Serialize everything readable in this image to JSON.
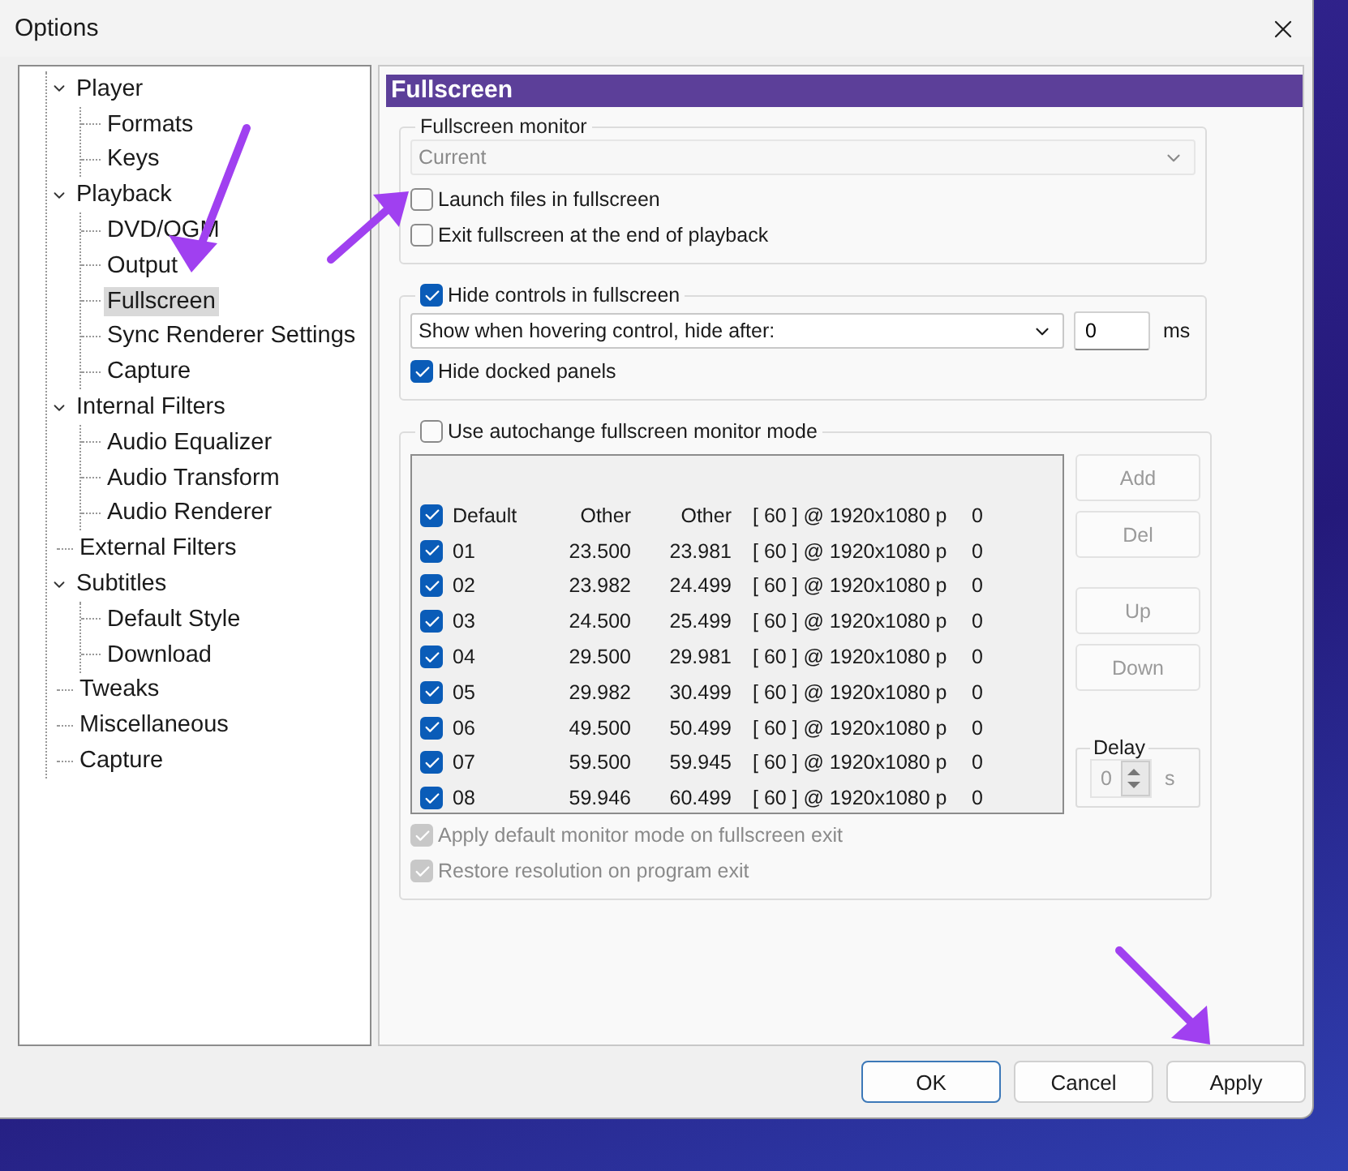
{
  "window": {
    "title": "Options"
  },
  "tree": [
    {
      "label": "Player",
      "expanded": true,
      "selected": false,
      "children": [
        {
          "label": "Formats",
          "selected": false
        },
        {
          "label": "Keys",
          "selected": false
        }
      ]
    },
    {
      "label": "Playback",
      "expanded": true,
      "selected": false,
      "children": [
        {
          "label": "DVD/OGM",
          "selected": false
        },
        {
          "label": "Output",
          "selected": false
        },
        {
          "label": "Fullscreen",
          "selected": true
        },
        {
          "label": "Sync Renderer Settings",
          "selected": false
        },
        {
          "label": "Capture",
          "selected": false
        }
      ]
    },
    {
      "label": "Internal Filters",
      "expanded": true,
      "selected": false,
      "children": [
        {
          "label": "Audio Equalizer",
          "selected": false
        },
        {
          "label": "Audio Transform",
          "selected": false
        },
        {
          "label": "Audio Renderer",
          "selected": false
        }
      ]
    },
    {
      "label": "External Filters",
      "selected": false
    },
    {
      "label": "Subtitles",
      "expanded": true,
      "selected": false,
      "children": [
        {
          "label": "Default Style",
          "selected": false
        },
        {
          "label": "Download",
          "selected": false
        }
      ]
    },
    {
      "label": "Tweaks",
      "selected": false
    },
    {
      "label": "Miscellaneous",
      "selected": false
    },
    {
      "label": "Capture",
      "selected": false
    }
  ],
  "panel": {
    "title": "Fullscreen",
    "monitor_group": {
      "label": "Fullscreen monitor",
      "dropdown": {
        "value": "Current",
        "disabled": true
      },
      "options": [
        {
          "label": "Launch files in fullscreen",
          "checked": false
        },
        {
          "label": "Exit fullscreen at the end of playback",
          "checked": false
        }
      ]
    },
    "hide_controls": {
      "label": "Hide controls in fullscreen",
      "checked": true,
      "dropdown": {
        "value": "Show when hovering control, hide after:"
      },
      "delay": {
        "value": "0",
        "unit": "ms"
      },
      "options": [
        {
          "label": "Hide docked panels",
          "checked": true
        }
      ]
    },
    "autochange": {
      "label": "Use autochange fullscreen monitor mode",
      "checked": false,
      "rows": [
        {
          "checked": true,
          "cells": [
            "Default",
            "Other",
            "Other",
            "[ 60 ] @ 1920x1080 p",
            "0"
          ]
        },
        {
          "checked": true,
          "cells": [
            "01",
            "23.500",
            "23.981",
            "[ 60 ] @ 1920x1080 p",
            "0"
          ]
        },
        {
          "checked": true,
          "cells": [
            "02",
            "23.982",
            "24.499",
            "[ 60 ] @ 1920x1080 p",
            "0"
          ]
        },
        {
          "checked": true,
          "cells": [
            "03",
            "24.500",
            "25.499",
            "[ 60 ] @ 1920x1080 p",
            "0"
          ]
        },
        {
          "checked": true,
          "cells": [
            "04",
            "29.500",
            "29.981",
            "[ 60 ] @ 1920x1080 p",
            "0"
          ]
        },
        {
          "checked": true,
          "cells": [
            "05",
            "29.982",
            "30.499",
            "[ 60 ] @ 1920x1080 p",
            "0"
          ]
        },
        {
          "checked": true,
          "cells": [
            "06",
            "49.500",
            "50.499",
            "[ 60 ] @ 1920x1080 p",
            "0"
          ]
        },
        {
          "checked": true,
          "cells": [
            "07",
            "59.500",
            "59.945",
            "[ 60 ] @ 1920x1080 p",
            "0"
          ]
        },
        {
          "checked": true,
          "cells": [
            "08",
            "59.946",
            "60.499",
            "[ 60 ] @ 1920x1080 p",
            "0"
          ]
        }
      ],
      "buttons": [
        {
          "label": "Add",
          "disabled": true
        },
        {
          "label": "Del",
          "disabled": true
        },
        {
          "label": "Up",
          "disabled": true
        },
        {
          "label": "Down",
          "disabled": true
        }
      ],
      "delay": {
        "label": "Delay",
        "value": "0",
        "unit": "s",
        "disabled": true
      },
      "options": [
        {
          "label": "Apply default monitor mode on fullscreen exit",
          "checked": true,
          "disabled": true
        },
        {
          "label": "Restore resolution on program exit",
          "checked": true,
          "disabled": true
        }
      ]
    }
  },
  "buttons": [
    {
      "label": "OK",
      "default": true
    },
    {
      "label": "Cancel",
      "default": false
    },
    {
      "label": "Apply",
      "default": false
    }
  ]
}
